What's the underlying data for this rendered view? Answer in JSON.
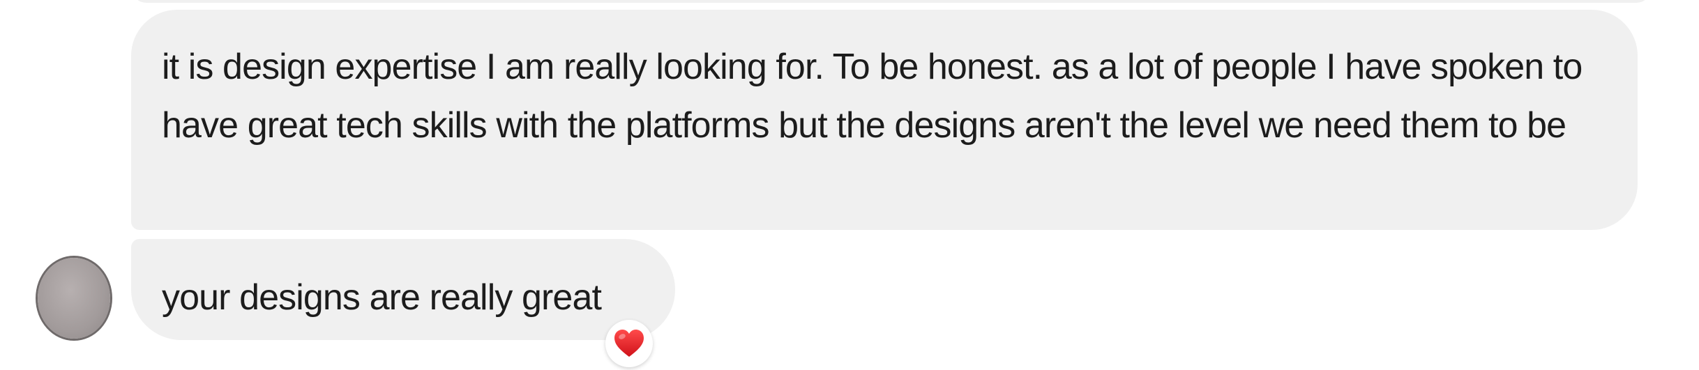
{
  "conversation": {
    "messages": [
      {
        "text": "it is design expertise I am really looking for. To be honest. as a lot of people I have spoken to have great tech skills with the platforms but the designs aren't the level we need them to be"
      },
      {
        "text": "your designs are really great",
        "reaction": "heart-icon"
      }
    ]
  },
  "colors": {
    "bubble_background": "#f0f0f0",
    "text": "#1c1c1c",
    "reaction_heart": "#e0191f",
    "avatar": "#a29b9b"
  }
}
